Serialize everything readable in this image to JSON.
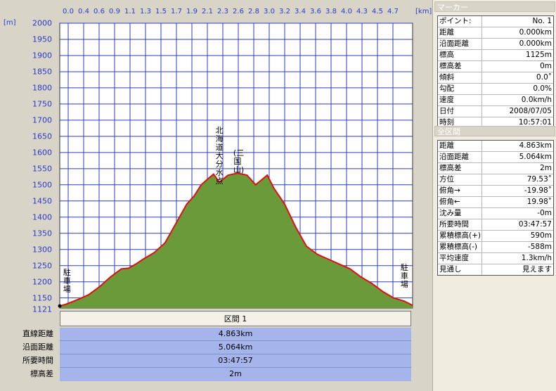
{
  "colors": {
    "axis_text": "#2b3bc8",
    "grid": "#2b3bc8",
    "profile_line": "#e01010",
    "profile_fill": "#6b9a3a",
    "plot_bg": "#ffffff",
    "stats_bg": "#a6b4ec"
  },
  "chart_data": {
    "type": "area",
    "x_unit": "[km]",
    "y_unit": "[m]",
    "x_ticks": [
      "0.0",
      "0.4",
      "0.6",
      "0.9",
      "1.1",
      "1.3",
      "1.5",
      "1.7",
      "1.9",
      "2.1",
      "2.3",
      "2.6",
      "2.8",
      "3.0",
      "3.2",
      "3.4",
      "3.6",
      "3.8",
      "4.0",
      "4.3",
      "4.5",
      "4.7"
    ],
    "y_ticks": [
      "2000",
      "1950",
      "1900",
      "1850",
      "1800",
      "1750",
      "1700",
      "1650",
      "1600",
      "1550",
      "1500",
      "1450",
      "1400",
      "1350",
      "1300",
      "1250",
      "1200",
      "1150",
      "1121"
    ],
    "xlim": [
      0,
      4.863
    ],
    "ylim": [
      1121,
      2000
    ],
    "x": [
      0.0,
      0.08,
      0.25,
      0.4,
      0.55,
      0.7,
      0.85,
      0.95,
      1.05,
      1.15,
      1.3,
      1.45,
      1.6,
      1.75,
      1.85,
      1.95,
      2.05,
      2.12,
      2.2,
      2.32,
      2.45,
      2.58,
      2.7,
      2.78,
      2.86,
      2.95,
      3.1,
      3.25,
      3.4,
      3.55,
      3.7,
      3.85,
      4.0,
      4.15,
      4.3,
      4.45,
      4.6,
      4.75,
      4.863
    ],
    "y": [
      1125,
      1130,
      1145,
      1160,
      1185,
      1215,
      1240,
      1242,
      1255,
      1270,
      1290,
      1320,
      1380,
      1440,
      1465,
      1500,
      1520,
      1533,
      1508,
      1530,
      1536,
      1530,
      1500,
      1515,
      1530,
      1490,
      1440,
      1370,
      1310,
      1285,
      1270,
      1255,
      1240,
      1215,
      1195,
      1170,
      1150,
      1140,
      1127
    ],
    "annotations": [
      {
        "text": "駐車場",
        "x": 0.1,
        "y": 1240
      },
      {
        "text": "北海道大分水点",
        "x": 2.2,
        "y": 1680
      },
      {
        "text": "(三国山)",
        "x": 2.45,
        "y": 1610
      },
      {
        "text": "駐車場",
        "x": 4.75,
        "y": 1255
      }
    ]
  },
  "section": {
    "label": "区間 1"
  },
  "stats": [
    {
      "label": "直線距離",
      "value": "4.863km"
    },
    {
      "label": "沿面距離",
      "value": "5.064km"
    },
    {
      "label": "所要時間",
      "value": "03:47:57"
    },
    {
      "label": "標高差",
      "value": "2m"
    }
  ],
  "marker_panel": {
    "title": "マーカー",
    "rows": [
      {
        "label": "ポイント:",
        "value": "No. 1"
      },
      {
        "label": "距離",
        "value": "0.000km"
      },
      {
        "label": "沿面距離",
        "value": "0.000km"
      },
      {
        "label": "標高",
        "value": "1125m"
      },
      {
        "label": "標高差",
        "value": "0m"
      },
      {
        "label": "傾斜",
        "value": "0.0˚"
      },
      {
        "label": "勾配",
        "value": "0.0%"
      },
      {
        "label": "速度",
        "value": "0.0km/h"
      },
      {
        "label": "日付",
        "value": "2008/07/05"
      },
      {
        "label": "時刻",
        "value": "10:57:01"
      }
    ]
  },
  "section_panel": {
    "title": "全区間",
    "rows": [
      {
        "label": "距離",
        "value": "4.863km"
      },
      {
        "label": "沿面距離",
        "value": "5.064km"
      },
      {
        "label": "標高差",
        "value": "2m"
      },
      {
        "label": "方位",
        "value": "79.53˚"
      },
      {
        "label": "俯角→",
        "value": "-19.98˚"
      },
      {
        "label": "俯角←",
        "value": "19.98˚"
      },
      {
        "label": "沈み量",
        "value": "-0m"
      },
      {
        "label": "所要時間",
        "value": "03:47:57"
      },
      {
        "label": "累積標高(+)",
        "value": "590m"
      },
      {
        "label": "累積標高(-)",
        "value": "-588m"
      },
      {
        "label": "平均速度",
        "value": "1.3km/h"
      },
      {
        "label": "見通し",
        "value": "見えます"
      }
    ]
  }
}
